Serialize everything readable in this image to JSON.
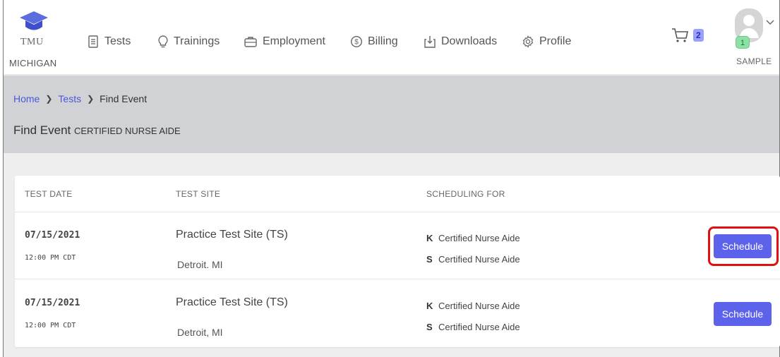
{
  "brand": {
    "line1": "TMU",
    "line2": "MICHIGAN"
  },
  "nav": [
    {
      "label": "Tests",
      "icon": "tests-icon"
    },
    {
      "label": "Trainings",
      "icon": "lightbulb-icon"
    },
    {
      "label": "Employment",
      "icon": "briefcase-icon"
    },
    {
      "label": "Billing",
      "icon": "dollar-icon"
    },
    {
      "label": "Downloads",
      "icon": "download-icon"
    },
    {
      "label": "Profile",
      "icon": "gear-icon"
    }
  ],
  "cart": {
    "icon": "cart-icon",
    "count": "2"
  },
  "user": {
    "badge": "1",
    "name": "SAMPLE"
  },
  "breadcrumb": {
    "home": "Home",
    "tests": "Tests",
    "current": "Find Event"
  },
  "page": {
    "title": "Find Event",
    "subtitle": "CERTIFIED NURSE AIDE"
  },
  "table": {
    "headers": [
      "TEST DATE",
      "TEST SITE",
      "SCHEDULING FOR"
    ],
    "rows": [
      {
        "date": "07/15/2021",
        "time": "12:00 PM CDT",
        "site": "Practice Test Site (TS)",
        "city": "Detroit. MI",
        "for": [
          {
            "code": "K",
            "name": "Certified Nurse Aide"
          },
          {
            "code": "S",
            "name": "Certified Nurse Aide"
          }
        ],
        "button": "Schedule"
      },
      {
        "date": "07/15/2021",
        "time": "12:00 PM CDT",
        "site": "Practice Test Site (TS)",
        "city": "Detroit, MI",
        "for": [
          {
            "code": "K",
            "name": "Certified Nurse Aide"
          },
          {
            "code": "S",
            "name": "Certified Nurse Aide"
          }
        ],
        "button": "Schedule"
      }
    ]
  },
  "colors": {
    "accent": "#5c63ea",
    "highlight": "#e01010",
    "band": "#d0d2d6",
    "link": "#4b58d8"
  }
}
